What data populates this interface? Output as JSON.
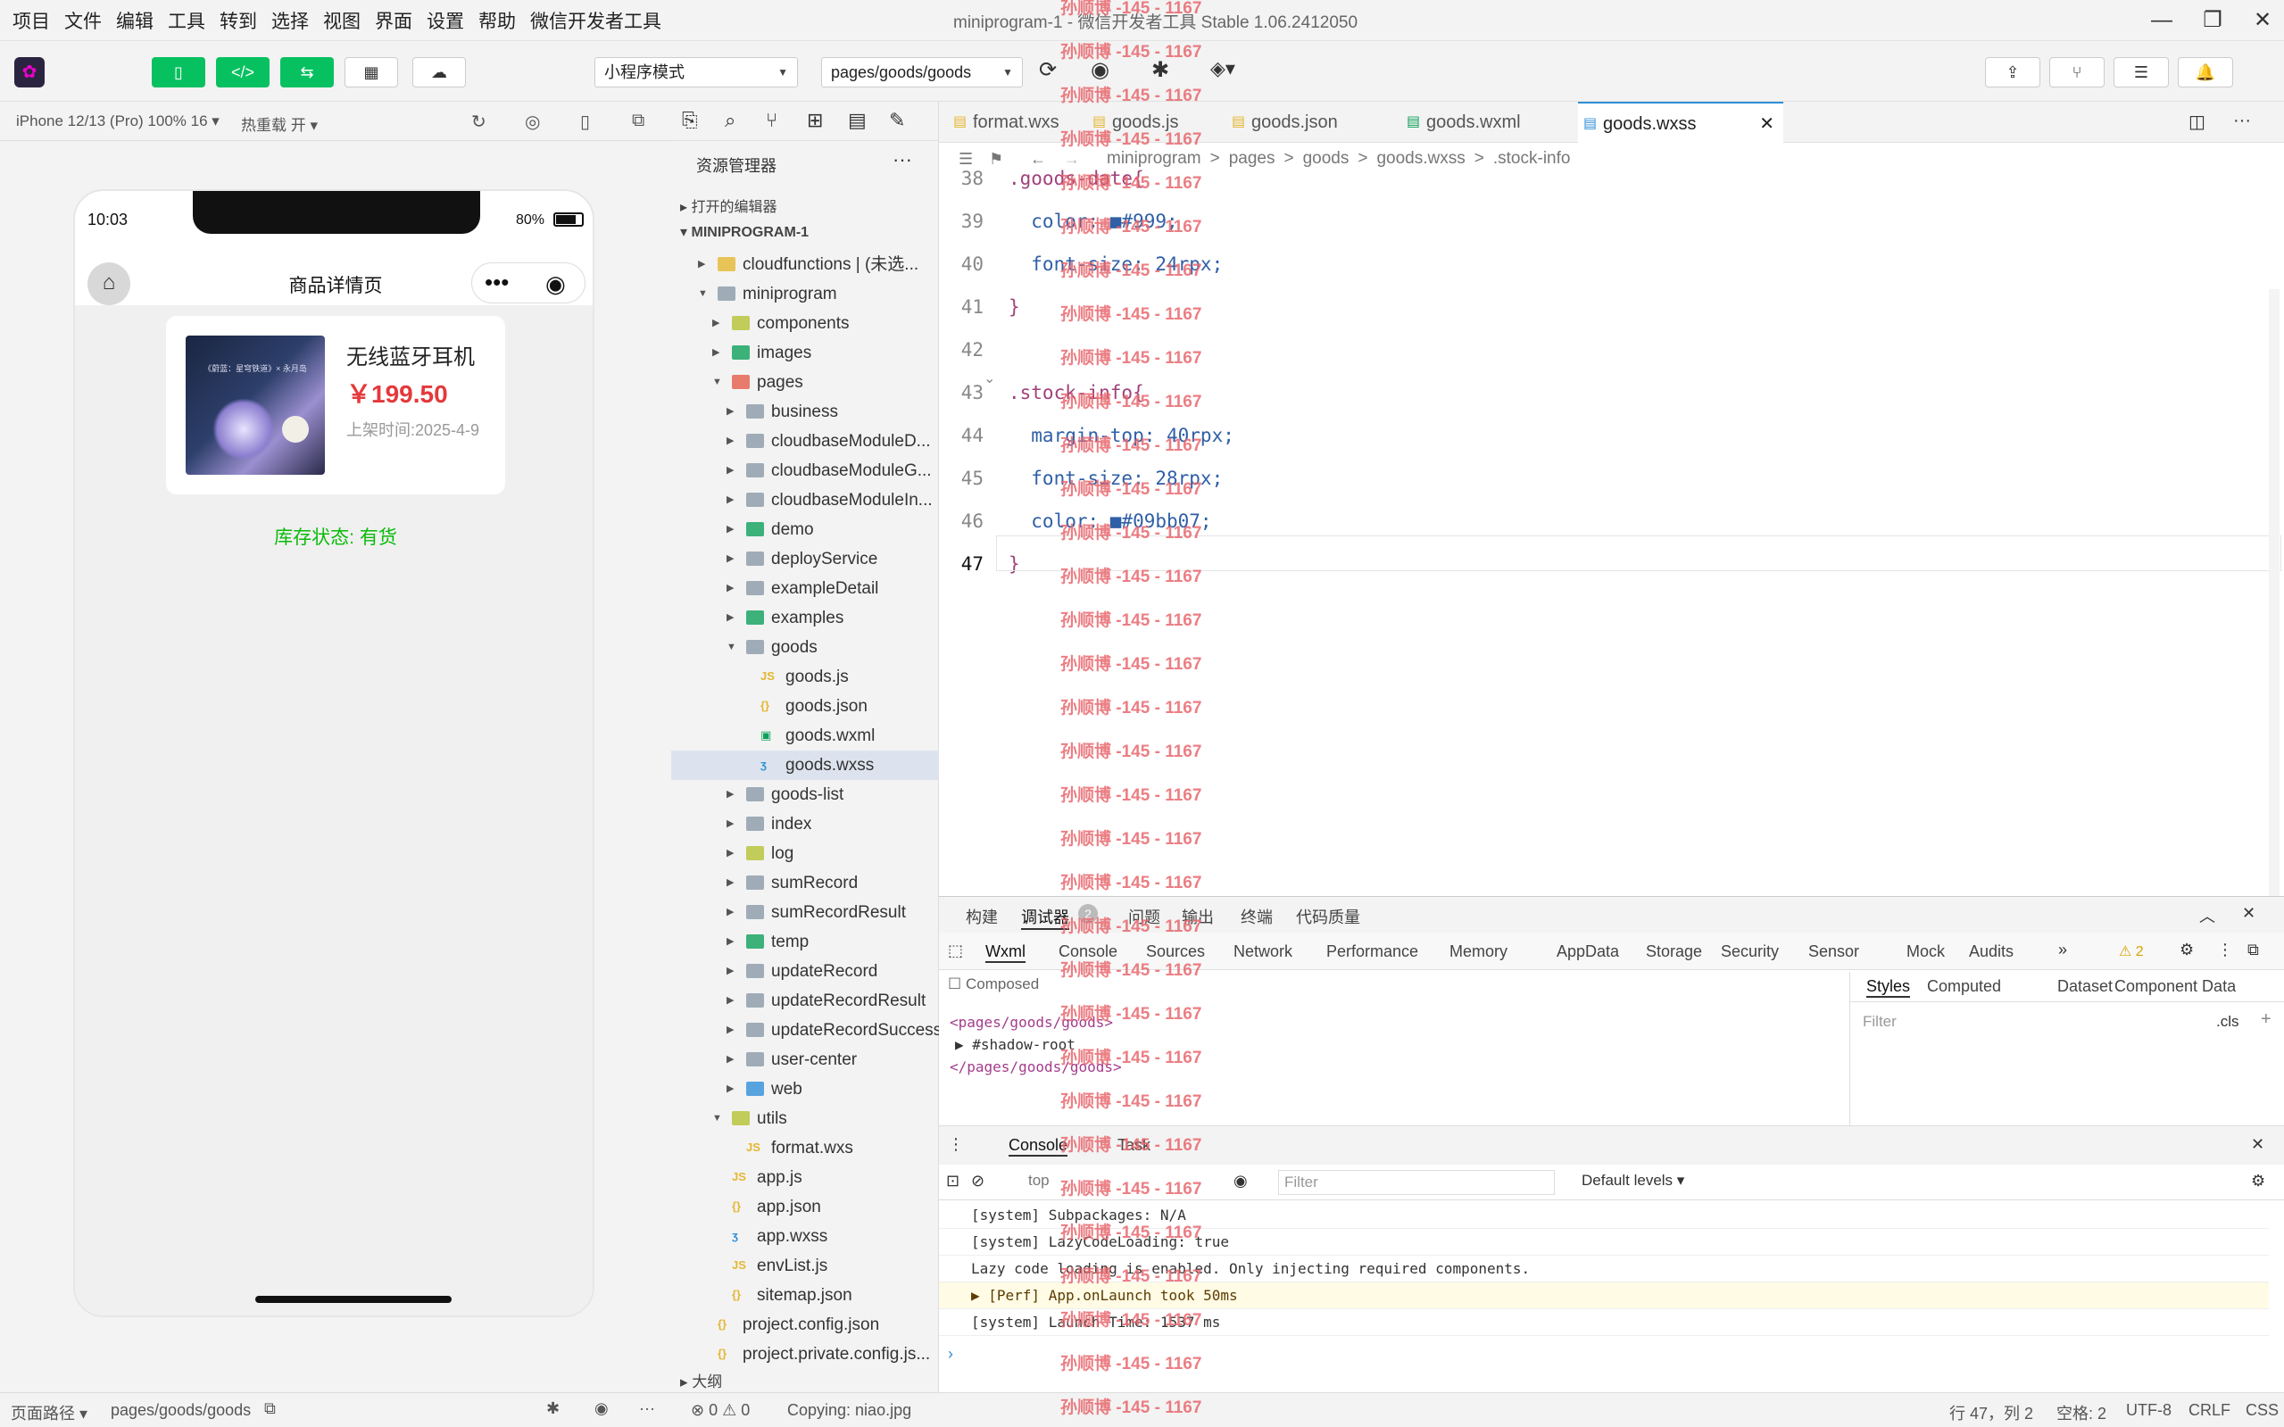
{
  "menu": [
    "项目",
    "文件",
    "编辑",
    "工具",
    "转到",
    "选择",
    "视图",
    "界面",
    "设置",
    "帮助",
    "微信开发者工具"
  ],
  "window_title": "miniprogram-1 - 微信开发者工具 Stable 1.06.2412050",
  "toolbar": {
    "mode": "小程序模式",
    "page_path": "pages/goods/goods"
  },
  "simbar": {
    "device": "iPhone 12/13 (Pro) 100% 16 ▾",
    "hotreload": "热重载 开 ▾"
  },
  "phone": {
    "time": "10:03",
    "battery": "80%",
    "nav_title": "商品详情页",
    "product_name": "无线蓝牙耳机",
    "price": "￥199.50",
    "date": "上架时间:2025-4-9",
    "stock": "库存状态: 有货",
    "cover_caption": "《蔚蓝：星穹铁道》× 永月岛"
  },
  "explorer": {
    "title": "资源管理器",
    "open_editors": "打开的编辑器",
    "root": "MINIPROGRAM-1",
    "outline": "大纲",
    "items": [
      {
        "label": "cloudfunctions | (未选...",
        "depth": 1,
        "type": "dir",
        "color": "#e5b631",
        "open": false
      },
      {
        "label": "miniprogram",
        "depth": 1,
        "type": "dir",
        "color": "#8a9aa8",
        "open": true
      },
      {
        "label": "components",
        "depth": 2,
        "type": "dir",
        "color": "#b5c233",
        "open": false
      },
      {
        "label": "images",
        "depth": 2,
        "type": "dir",
        "color": "#0ea05a",
        "open": false
      },
      {
        "label": "pages",
        "depth": 2,
        "type": "dir",
        "color": "#e35e4a",
        "open": true
      },
      {
        "label": "business",
        "depth": 3,
        "type": "dir",
        "color": "#8a9aa8",
        "open": false
      },
      {
        "label": "cloudbaseModuleD...",
        "depth": 3,
        "type": "dir",
        "color": "#8a9aa8",
        "open": false
      },
      {
        "label": "cloudbaseModuleG...",
        "depth": 3,
        "type": "dir",
        "color": "#8a9aa8",
        "open": false
      },
      {
        "label": "cloudbaseModuleIn...",
        "depth": 3,
        "type": "dir",
        "color": "#8a9aa8",
        "open": false
      },
      {
        "label": "demo",
        "depth": 3,
        "type": "dir",
        "color": "#0ea05a",
        "open": false
      },
      {
        "label": "deployService",
        "depth": 3,
        "type": "dir",
        "color": "#8a9aa8",
        "open": false
      },
      {
        "label": "exampleDetail",
        "depth": 3,
        "type": "dir",
        "color": "#8a9aa8",
        "open": false
      },
      {
        "label": "examples",
        "depth": 3,
        "type": "dir",
        "color": "#0ea05a",
        "open": false
      },
      {
        "label": "goods",
        "depth": 3,
        "type": "dir",
        "color": "#8a9aa8",
        "open": true
      },
      {
        "label": "goods.js",
        "depth": 4,
        "type": "js",
        "color": "#e5b631"
      },
      {
        "label": "goods.json",
        "depth": 4,
        "type": "json",
        "color": "#e5b631"
      },
      {
        "label": "goods.wxml",
        "depth": 4,
        "type": "wxml",
        "color": "#0ea05a"
      },
      {
        "label": "goods.wxss",
        "depth": 4,
        "type": "wxss",
        "color": "#2f8fd8",
        "selected": true
      },
      {
        "label": "goods-list",
        "depth": 3,
        "type": "dir",
        "color": "#8a9aa8",
        "open": false
      },
      {
        "label": "index",
        "depth": 3,
        "type": "dir",
        "color": "#8a9aa8",
        "open": false
      },
      {
        "label": "log",
        "depth": 3,
        "type": "dir",
        "color": "#b5c233",
        "open": false
      },
      {
        "label": "sumRecord",
        "depth": 3,
        "type": "dir",
        "color": "#8a9aa8",
        "open": false
      },
      {
        "label": "sumRecordResult",
        "depth": 3,
        "type": "dir",
        "color": "#8a9aa8",
        "open": false
      },
      {
        "label": "temp",
        "depth": 3,
        "type": "dir",
        "color": "#0ea05a",
        "open": false
      },
      {
        "label": "updateRecord",
        "depth": 3,
        "type": "dir",
        "color": "#8a9aa8",
        "open": false
      },
      {
        "label": "updateRecordResult",
        "depth": 3,
        "type": "dir",
        "color": "#8a9aa8",
        "open": false
      },
      {
        "label": "updateRecordSuccess",
        "depth": 3,
        "type": "dir",
        "color": "#8a9aa8",
        "open": false
      },
      {
        "label": "user-center",
        "depth": 3,
        "type": "dir",
        "color": "#8a9aa8",
        "open": false
      },
      {
        "label": "web",
        "depth": 3,
        "type": "dir",
        "color": "#2f8fd8",
        "open": false
      },
      {
        "label": "utils",
        "depth": 2,
        "type": "dir",
        "color": "#b5c233",
        "open": true
      },
      {
        "label": "format.wxs",
        "depth": 3,
        "type": "js",
        "color": "#e5b631"
      },
      {
        "label": "app.js",
        "depth": 2,
        "type": "js",
        "color": "#e5b631"
      },
      {
        "label": "app.json",
        "depth": 2,
        "type": "json",
        "color": "#e5b631"
      },
      {
        "label": "app.wxss",
        "depth": 2,
        "type": "wxss",
        "color": "#2f8fd8"
      },
      {
        "label": "envList.js",
        "depth": 2,
        "type": "js",
        "color": "#e5b631"
      },
      {
        "label": "sitemap.json",
        "depth": 2,
        "type": "json",
        "color": "#e5b631"
      },
      {
        "label": "project.config.json",
        "depth": 1,
        "type": "json",
        "color": "#e5b631"
      },
      {
        "label": "project.private.config.js...",
        "depth": 1,
        "type": "json",
        "color": "#e5b631"
      }
    ]
  },
  "editor": {
    "tabs": [
      {
        "label": "format.wxs",
        "color": "#e5b631"
      },
      {
        "label": "goods.js",
        "color": "#e5b631"
      },
      {
        "label": "goods.json",
        "color": "#e5b631"
      },
      {
        "label": "goods.wxml",
        "color": "#0ea05a"
      },
      {
        "label": "goods.wxss",
        "color": "#2f8fd8",
        "active": true
      }
    ],
    "crumbs": [
      "miniprogram",
      ">",
      "pages",
      ">",
      "goods",
      ">",
      "goods.wxss",
      ">",
      ".stock-info"
    ],
    "lines": [
      {
        "n": "38",
        "t": ".goods-date{"
      },
      {
        "n": "39",
        "t": "  color: ■#999;"
      },
      {
        "n": "40",
        "t": "  font-size: 24rpx;"
      },
      {
        "n": "41",
        "t": "}"
      },
      {
        "n": "42",
        "t": ""
      },
      {
        "n": "43",
        "t": ".stock-info{"
      },
      {
        "n": "44",
        "t": "  margin-top: 40rpx;"
      },
      {
        "n": "45",
        "t": "  font-size: 28rpx;"
      },
      {
        "n": "46",
        "t": "  color: ■#09bb07;"
      },
      {
        "n": "47",
        "t": "}"
      }
    ]
  },
  "devtools": {
    "top_tabs": [
      "构建",
      "调试器",
      "问题",
      "输出",
      "终端",
      "代码质量"
    ],
    "debugger_badge": "2",
    "panel_tabs": [
      "Wxml",
      "Console",
      "Sources",
      "Network",
      "Performance",
      "Memory",
      "AppData",
      "Storage",
      "Security",
      "Sensor",
      "Mock",
      "Audits"
    ],
    "warn_count": "2",
    "composed": "Composed",
    "wxml": [
      "<pages/goods/goods>",
      "▶ #shadow-root",
      "</pages/goods/goods>"
    ],
    "style_tabs": [
      "Styles",
      "Computed",
      "Dataset",
      "Component Data"
    ],
    "filter": "Filter",
    "cls": ".cls",
    "console_tabs": [
      "Console",
      "Task"
    ],
    "context": "top",
    "filter2": "Filter",
    "levels": "Default levels ▾",
    "console_lines": [
      "[system] Subpackages: N/A",
      "[system] LazyCodeLoading: true",
      "Lazy code loading is enabled. Only injecting required components.",
      "▶ [Perf] App.onLaunch took 50ms",
      "[system] Launch Time: 1537 ms"
    ]
  },
  "status": {
    "page_label": "页面路径 ▾",
    "page_path": "pages/goods/goods",
    "problems": "⊗ 0 ⚠ 0",
    "copying": "Copying: niao.jpg",
    "pos": "行 47，列 2",
    "spaces": "空格: 2",
    "enc": "UTF-8",
    "eol": "CRLF",
    "lang": "CSS"
  },
  "watermark": "孙顺博 -145 - 1167"
}
